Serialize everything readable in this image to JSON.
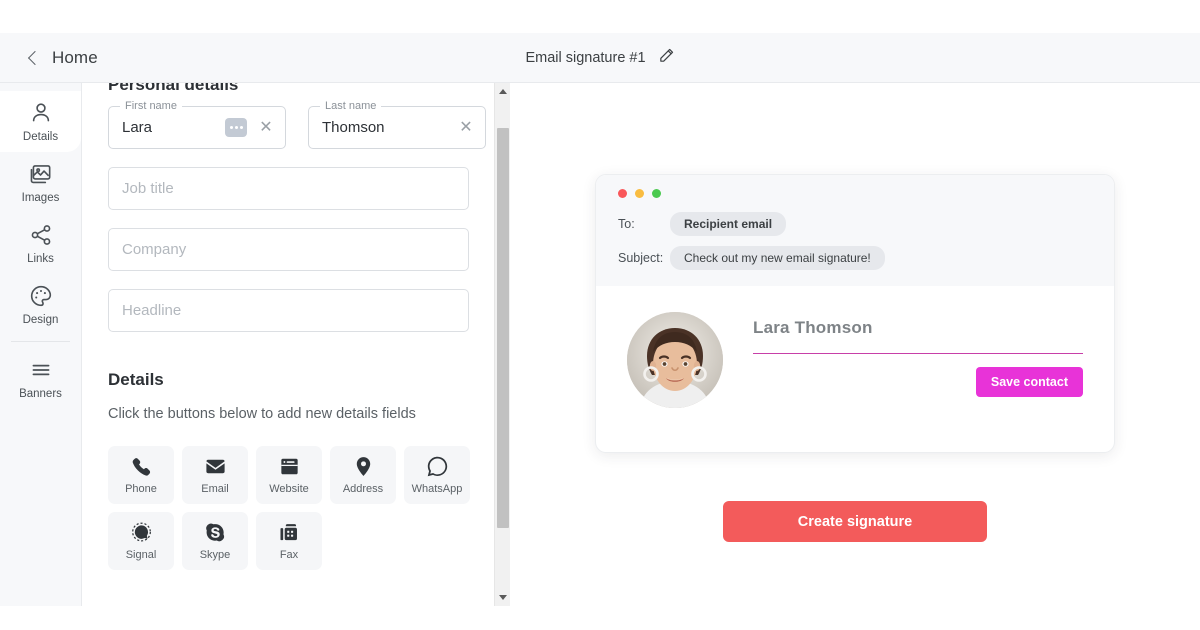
{
  "header": {
    "back_label": "Home",
    "back_icon": "chevron-left-icon",
    "doc_title": "Email signature #1",
    "edit_icon": "pencil-icon"
  },
  "sidebar": {
    "items": [
      {
        "label": "Details",
        "icon": "user-icon",
        "active": true
      },
      {
        "label": "Images",
        "icon": "image-icon",
        "active": false
      },
      {
        "label": "Links",
        "icon": "share-icon",
        "active": false
      },
      {
        "label": "Design",
        "icon": "palette-icon",
        "active": false
      },
      {
        "label": "Banners",
        "icon": "lines-icon",
        "active": false
      }
    ]
  },
  "form": {
    "section_title": "Personal details",
    "first_name": {
      "legend": "First name",
      "value": "Lara",
      "more_icon": "ellipsis-badge-icon",
      "clear_icon": "close-icon"
    },
    "last_name": {
      "legend": "Last name",
      "value": "Thomson",
      "clear_icon": "close-icon"
    },
    "job_title": {
      "placeholder": "Job title",
      "value": ""
    },
    "company": {
      "placeholder": "Company",
      "value": ""
    },
    "headline": {
      "placeholder": "Headline",
      "value": ""
    },
    "details_heading": "Details",
    "details_subtext": "Click the buttons below to add new details fields",
    "detail_buttons": [
      {
        "label": "Phone",
        "icon": "phone-icon"
      },
      {
        "label": "Email",
        "icon": "envelope-icon"
      },
      {
        "label": "Website",
        "icon": "browser-icon"
      },
      {
        "label": "Address",
        "icon": "map-pin-icon"
      },
      {
        "label": "WhatsApp",
        "icon": "whatsapp-icon"
      },
      {
        "label": "Signal",
        "icon": "signal-icon"
      },
      {
        "label": "Skype",
        "icon": "skype-icon"
      },
      {
        "label": "Fax",
        "icon": "fax-icon"
      }
    ]
  },
  "preview": {
    "window_lights": [
      "#f9575a",
      "#f9bc40",
      "#4ac94f"
    ],
    "to_label": "To:",
    "to_value": "Recipient email",
    "subject_label": "Subject:",
    "subject_value": "Check out my new email signature!",
    "signature": {
      "name": "Lara Thomson",
      "avatar_alt": "portrait-photo",
      "rule_color": "#c73fa8",
      "save_button": {
        "label": "Save contact",
        "color": "#e833d8"
      }
    }
  },
  "cta": {
    "label": "Create signature",
    "color": "#f35b5b"
  },
  "scrollbar": {
    "up_icon": "caret-up-icon",
    "down_icon": "caret-down-icon"
  }
}
